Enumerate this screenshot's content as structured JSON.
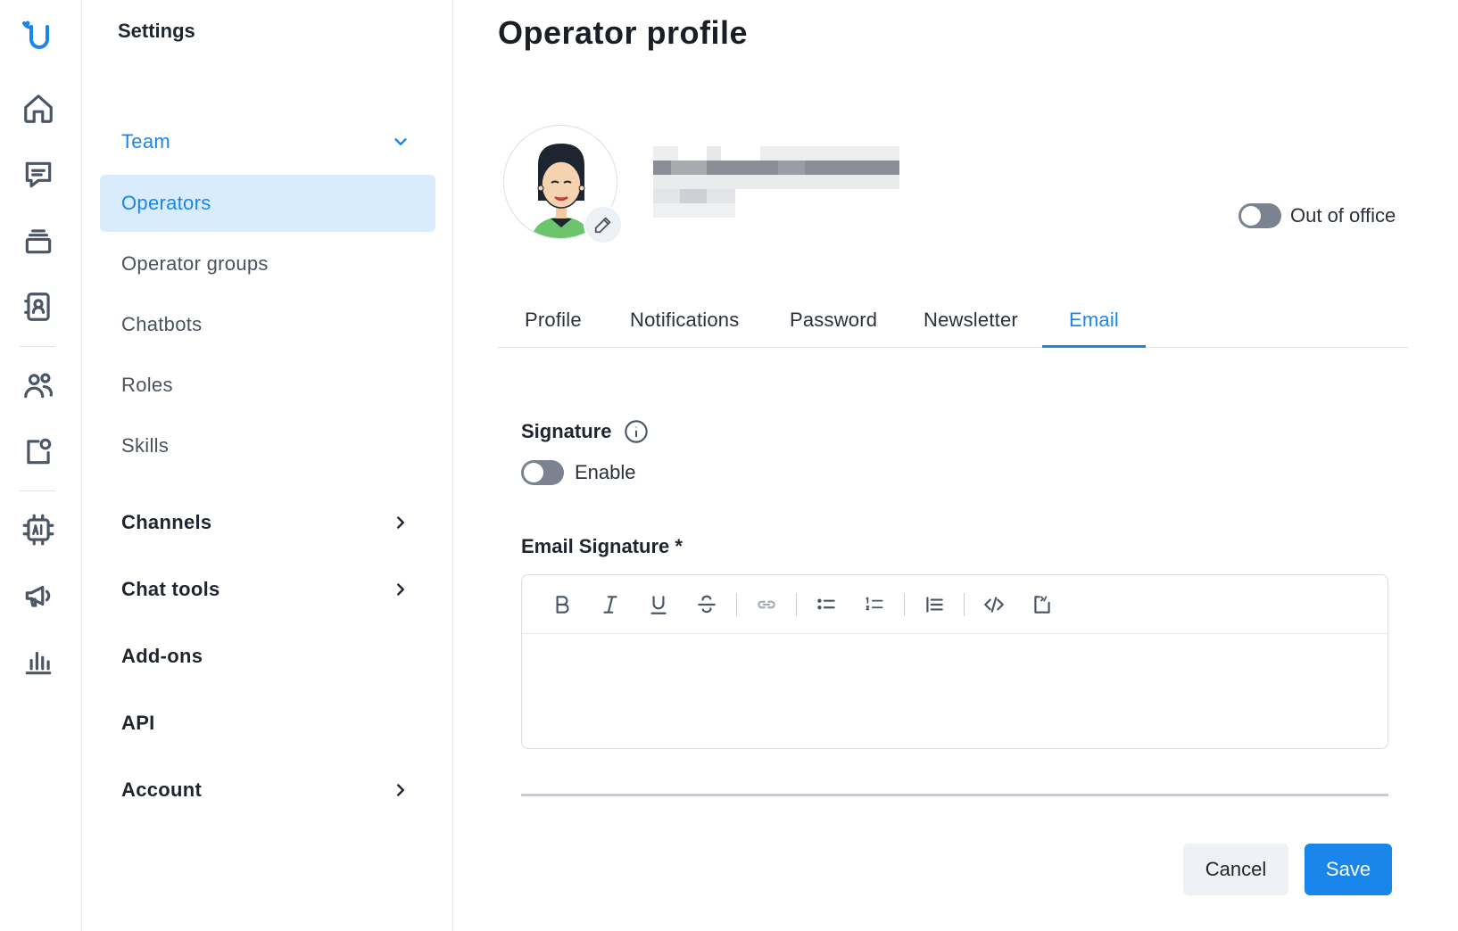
{
  "settings": {
    "title": "Settings"
  },
  "nav": {
    "team": "Team",
    "operators": "Operators",
    "operator_groups": "Operator groups",
    "chatbots": "Chatbots",
    "roles": "Roles",
    "skills": "Skills",
    "channels": "Channels",
    "chat_tools": "Chat tools",
    "add_ons": "Add-ons",
    "api": "API",
    "account": "Account"
  },
  "page": {
    "title": "Operator profile"
  },
  "profile": {
    "out_of_office_label": "Out of office"
  },
  "tabs": [
    "Profile",
    "Notifications",
    "Password",
    "Newsletter",
    "Email"
  ],
  "signature": {
    "title": "Signature",
    "enable_label": "Enable",
    "email_signature_label": "Email Signature *"
  },
  "actions": {
    "cancel": "Cancel",
    "save": "Save"
  },
  "colors": {
    "accent": "#1a86ec",
    "active_bg": "#d9ecfd"
  }
}
